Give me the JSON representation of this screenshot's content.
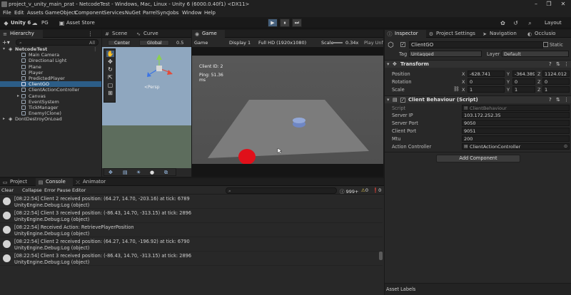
{
  "window": {
    "title": "project_v_unity_main_prat - NetcodeTest - Windows, Mac, Linux - Unity 6 (6000.0.40f1) <DX11>",
    "min": "–",
    "max": "❐",
    "close": "✕"
  },
  "menu": [
    "File",
    "Edit",
    "Assets",
    "GameObject",
    "Component",
    "Services",
    "NuGet",
    "ParrelSync",
    "Jobs",
    "Window",
    "Help"
  ],
  "toolbar": {
    "account": "Unity 6",
    "user": "PG",
    "asset_store": "Asset Store",
    "layout": "Layout",
    "play_icon": "▶",
    "pause_icon": "⏸",
    "step_icon": "⏭"
  },
  "hierarchy": {
    "tab": "Hierarchy",
    "search_placeholder": "All",
    "scene": "NetcodeTest",
    "items": [
      "Main Camera",
      "Directional Light",
      "Plane",
      "Player",
      "PredictedPlayer",
      "ClientGO",
      "ClientActionController",
      "Canvas",
      "EventSystem",
      "TickManager",
      "Enemy(Clone)"
    ],
    "dont_destroy": "DontDestroyOnLoad"
  },
  "scene_panel": {
    "tab_scene": "Scene",
    "tab_curve": "Curve",
    "pivot": "Center",
    "space": "Global",
    "snap": "0.5"
  },
  "game_panel": {
    "tab": "Game",
    "mode": "Game",
    "display": "Display 1",
    "resolution": "Full HD (1920x1080)",
    "scale_label": "Scale",
    "scale_value": "0.34x",
    "play_unfocused": "Play Unf",
    "client_id": "Client ID: 2",
    "ping_line1": "Ping: 51.36",
    "ping_line2": "ms"
  },
  "console": {
    "tab_project": "Project",
    "tab_console": "Console",
    "tab_animator": "Animator",
    "clear": "Clear",
    "collapse": "Collapse",
    "error_pause": "Error Pause",
    "editor": "Editor",
    "log_count": "999+",
    "warn_count": "0",
    "error_count": "0",
    "entries": [
      {
        "line1": "[08:22:54] Client 2 received position: (64.27, 14.70, -203.16) at tick: 6789",
        "line2": "UnityEngine.Debug:Log (object)"
      },
      {
        "line1": "[08:22:54] Client 3 received position: (-86.43, 14.70, -313.15) at tick: 2896",
        "line2": "UnityEngine.Debug:Log (object)"
      },
      {
        "line1": "[08:22:54] Received Action: RetrievePlayerPosition",
        "line2": "UnityEngine.Debug:Log (object)"
      },
      {
        "line1": "[08:22:54] Client 2 received position: (64.27, 14.70, -196.92) at tick: 6790",
        "line2": "UnityEngine.Debug:Log (object)"
      },
      {
        "line1": "[08:22:54] Client 3 received position: (-86.43, 14.70, -313.15) at tick: 2896",
        "line2": "UnityEngine.Debug:Log (object)"
      }
    ]
  },
  "inspector": {
    "tab_inspector": "Inspector",
    "tab_project_settings": "Project Settings",
    "tab_navigation": "Navigation",
    "tab_occlusion": "Occlusio",
    "object_name": "ClientGO",
    "static_label": "Static",
    "tag_label": "Tag",
    "tag_value": "Untagged",
    "layer_label": "Layer",
    "layer_value": "Default",
    "transform": {
      "header": "Transform",
      "position_label": "Position",
      "rotation_label": "Rotation",
      "scale_label": "Scale",
      "position": {
        "x": "-628.741",
        "y": "-364.3897",
        "z": "1124.012"
      },
      "rotation": {
        "x": "0",
        "y": "0",
        "z": "0"
      },
      "scale": {
        "x": "1",
        "y": "1",
        "z": "1"
      }
    },
    "client_behaviour": {
      "header": "Client Behaviour (Script)",
      "script_label": "Script",
      "script_value": "ClientBehaviour",
      "server_ip_label": "Server IP",
      "server_ip": "103.172.252.35",
      "server_port_label": "Server Port",
      "server_port": "9050",
      "client_port_label": "Client Port",
      "client_port": "9051",
      "mtu_label": "Mtu",
      "mtu": "200",
      "action_controller_label": "Action Controller",
      "action_controller": "ClientActionController"
    },
    "add_component": "Add Component",
    "asset_labels": "Asset Labels"
  },
  "colors": {
    "accent_select": "#2c5d87",
    "play_active": "#46607c",
    "scene_sky": "#8fa7bf",
    "game_bg": "#545454",
    "plane": "#7c7c7c",
    "enemy": "#e0101a",
    "player": "#7f95c9"
  }
}
